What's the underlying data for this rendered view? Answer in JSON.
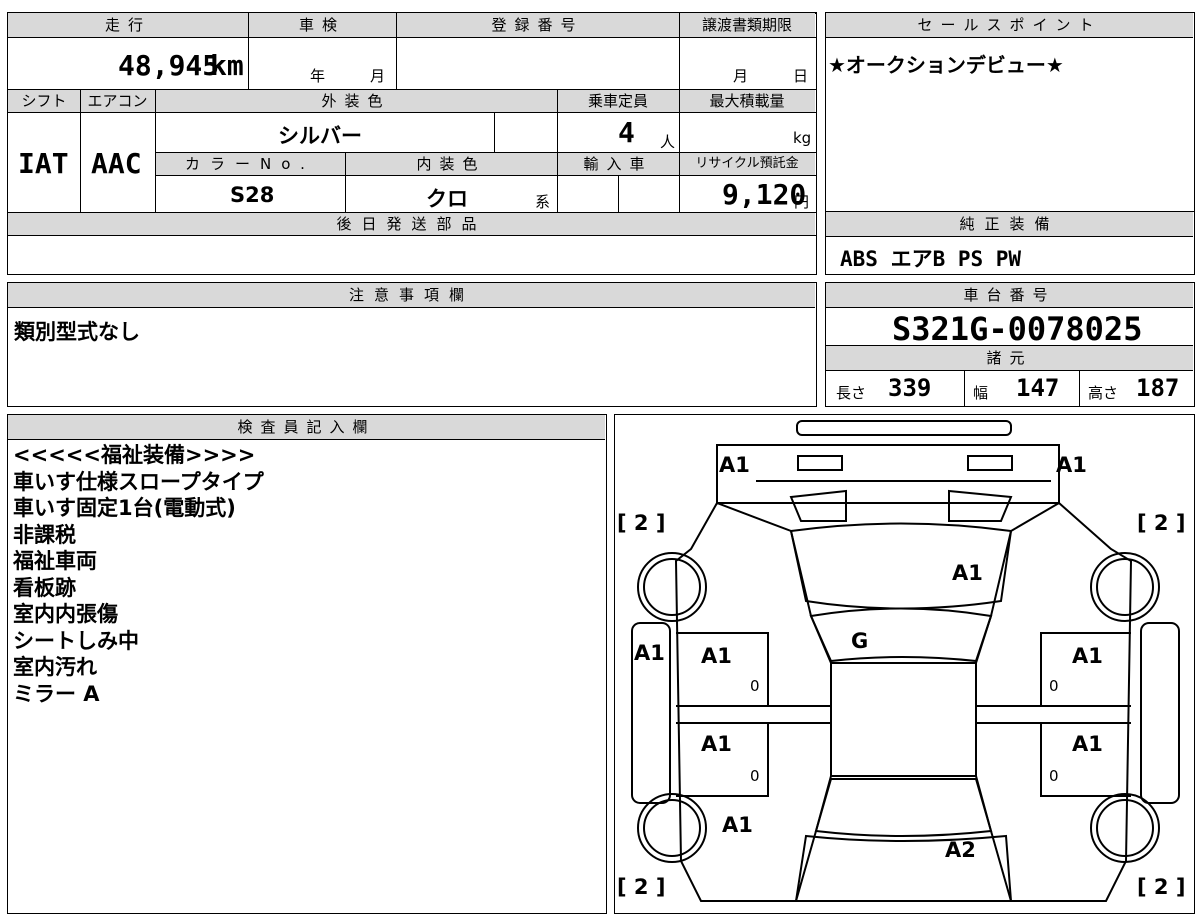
{
  "vehicle_info": {
    "headers": {
      "mileage": "走行",
      "inspection": "車検",
      "registration_number": "登録番号",
      "transfer_deadline": "譲渡書類期限",
      "shift": "シフト",
      "aircon": "エアコン",
      "exterior_color": "外装色",
      "capacity": "乗車定員",
      "max_load": "最大積載量",
      "color_no": "カラーNo.",
      "interior_color": "内装色",
      "import": "輸入車",
      "recycle_fee": "リサイクル預託金",
      "later_parts": "後日発送部品"
    },
    "mileage_value": "48,945",
    "mileage_unit": "km",
    "inspection_year_label": "年",
    "inspection_month_label": "月",
    "deadline_month_label": "月",
    "deadline_day_label": "日",
    "shift_value": "IAT",
    "aircon_value": "AAC",
    "exterior_color_value": "シルバー",
    "capacity_value": "4",
    "capacity_unit": "人",
    "max_load_unit": "kg",
    "color_no_value": "S28",
    "interior_color_value": "クロ",
    "interior_color_suffix": "系",
    "recycle_fee_value": "9,120",
    "recycle_fee_unit": "円"
  },
  "sales_point": {
    "header": "セールスポイント",
    "text": "★オークションデビュー★"
  },
  "standard_equipment": {
    "header": "純正装備",
    "text": "ABS エアB PS PW"
  },
  "notes": {
    "header": "注意事項欄",
    "text": "類別型式なし"
  },
  "chassis": {
    "header": "車台番号",
    "value": "S321G-0078025",
    "specs_header": "諸元",
    "length_label": "長さ",
    "length_value": "339",
    "width_label": "幅",
    "width_value": "147",
    "height_label": "高さ",
    "height_value": "187"
  },
  "inspector": {
    "header": "検査員記入欄",
    "lines": [
      "<<<<<福祉装備>>>>",
      "車いす仕様スロープタイプ",
      "車いす固定1台(電動式)",
      "非課税",
      "福祉車両",
      "看板跡",
      "室内内張傷",
      "シートしみ中",
      "室内汚れ",
      "ミラー A"
    ]
  },
  "diagram": {
    "marks": {
      "front_left": "A1",
      "front_right": "A1",
      "hood": "A1",
      "windshield": "G",
      "left_side": "A1",
      "front_left_door": "A1",
      "front_right_door": "A1",
      "rear_left_door": "A1",
      "rear_right_door": "A1",
      "rear_left": "A1",
      "rear": "A2",
      "door_fl_small": "0",
      "door_fr_small": "0",
      "door_rl_small": "0",
      "door_rr_small": "0",
      "tire_fl": "[ 2 ]",
      "tire_fr": "[ 2 ]",
      "tire_rl": "[ 2 ]",
      "tire_rr": "[ 2 ]"
    }
  }
}
